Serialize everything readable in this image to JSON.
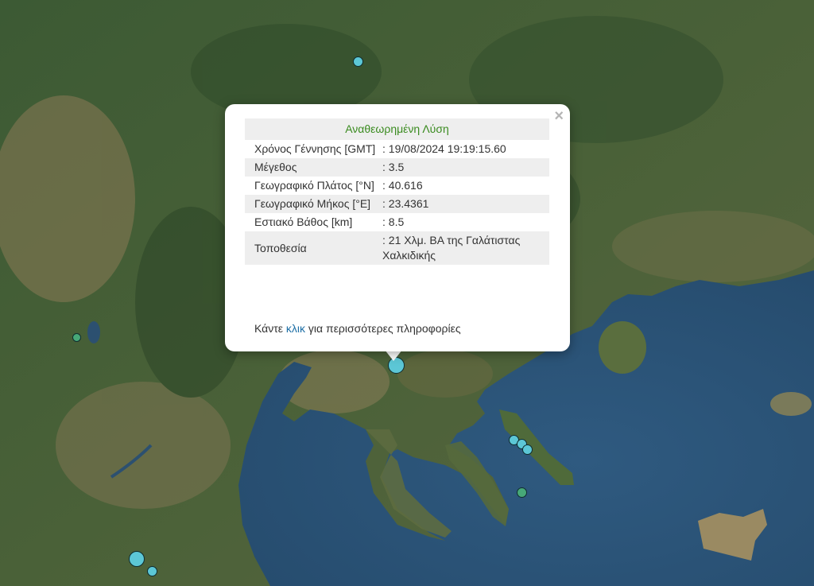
{
  "popup": {
    "title": "Αναθεωρημένη Λύση",
    "close_glyph": "×",
    "rows": [
      {
        "label": "Χρόνος Γέννησης [GMT]",
        "value": ": 19/08/2024 19:19:15.60"
      },
      {
        "label": "Μέγεθος",
        "value": ": 3.5"
      },
      {
        "label": "Γεωγραφικό Πλάτος [°N]",
        "value": ": 40.616"
      },
      {
        "label": "Γεωγραφικό Μήκος [°E]",
        "value": ": 23.4361"
      },
      {
        "label": "Εστιακό Βάθος [km]",
        "value": ": 8.5"
      },
      {
        "label": "Τοποθεσία",
        "value": ": 21 Χλμ. ΒΑ της Γαλάτιστας Χαλκιδικής"
      }
    ],
    "more_prefix": "Κάντε ",
    "more_link": "κλικ",
    "more_suffix": " για περισσότερες πληροφορίες"
  },
  "colors": {
    "marker_recent": "#5cc7d6",
    "marker_older": "#47a878",
    "title_green": "#3a8b1f",
    "link_blue": "#1e6fa6",
    "sea": "#2b5478",
    "land": "#3f5d35"
  }
}
